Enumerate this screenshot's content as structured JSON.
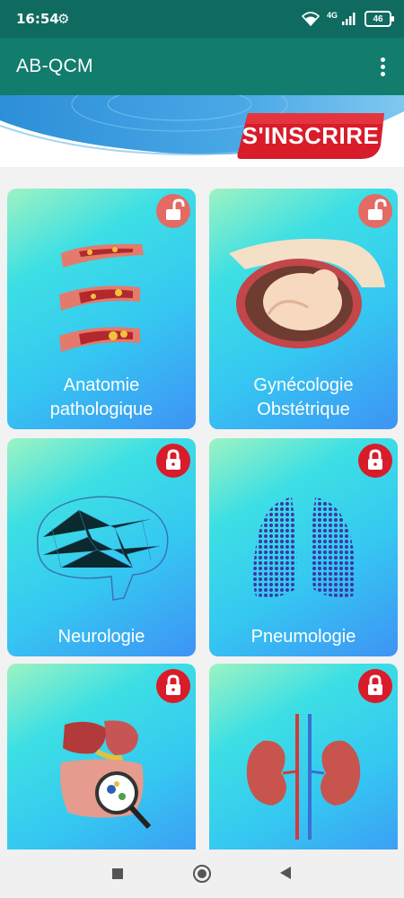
{
  "status": {
    "time": "16:54",
    "network": "4G",
    "battery": "46"
  },
  "app": {
    "title": "AB-QCM"
  },
  "banner": {
    "signup_label": "S'INSCRIRE"
  },
  "colors": {
    "status_bar": "#0f6b5f",
    "app_bar": "#127c6d",
    "lock_locked": "#d81c2a",
    "lock_unlocked": "#e46a64",
    "signup": "#d81c2a"
  },
  "cards": [
    {
      "title_line1": "Anatomie",
      "title_line2": "pathologique",
      "icon": "blood-vessel-icon",
      "locked": false
    },
    {
      "title_line1": "Gynécologie",
      "title_line2": "Obstétrique",
      "icon": "fetus-womb-icon",
      "locked": false
    },
    {
      "title_line1": "Neurologie",
      "title_line2": "",
      "icon": "brain-icon",
      "locked": true
    },
    {
      "title_line1": "Pneumologie",
      "title_line2": "",
      "icon": "lungs-icon",
      "locked": true
    },
    {
      "title_line1": "",
      "title_line2": "",
      "icon": "digestive-system-icon",
      "locked": true
    },
    {
      "title_line1": "",
      "title_line2": "",
      "icon": "kidneys-icon",
      "locked": true
    }
  ]
}
